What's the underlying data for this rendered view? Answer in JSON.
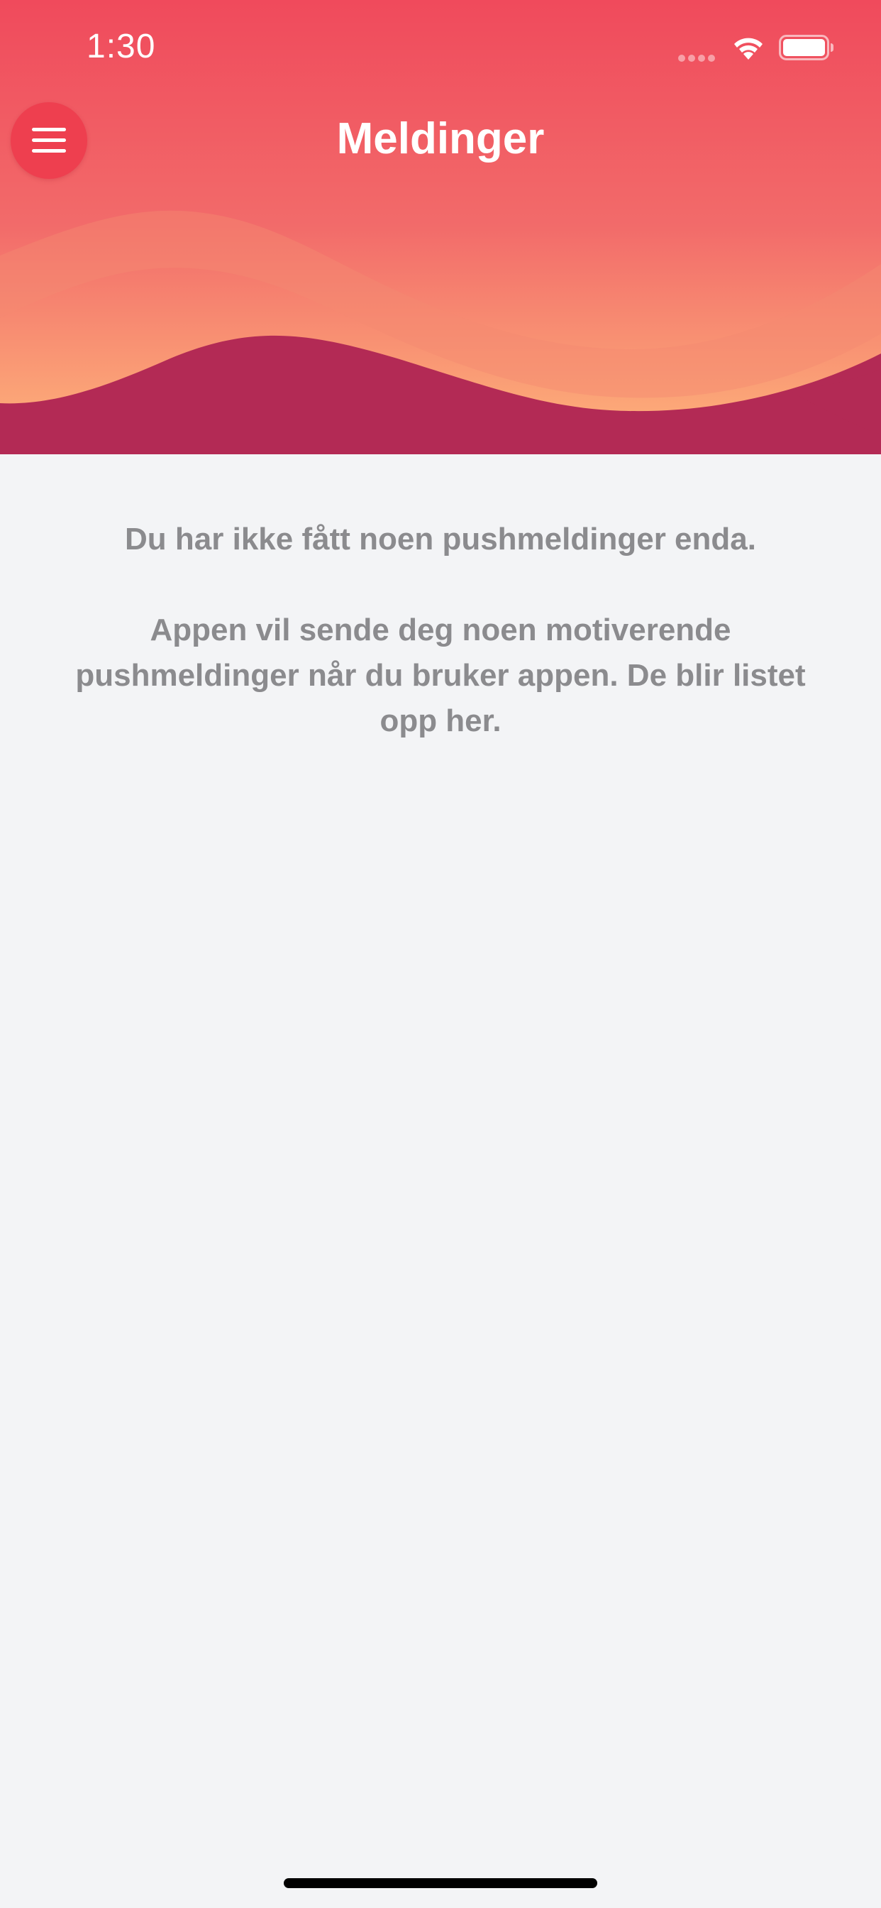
{
  "status_bar": {
    "time": "1:30"
  },
  "header": {
    "title": "Meldinger",
    "menu_icon": "hamburger-menu-icon"
  },
  "empty_state": {
    "line_1": "Du har ikke fått noen pushmeldinger enda.",
    "line_2": "Appen vil sende deg noen motiverende pushmeldinger når du bruker appen. De blir listet opp her."
  },
  "colors": {
    "header_red": "#f04a5c",
    "wave_orange": "#fca878",
    "wave_dark": "#b32a55",
    "background": "#f3f4f6",
    "text_gray": "#8b8b8e"
  }
}
